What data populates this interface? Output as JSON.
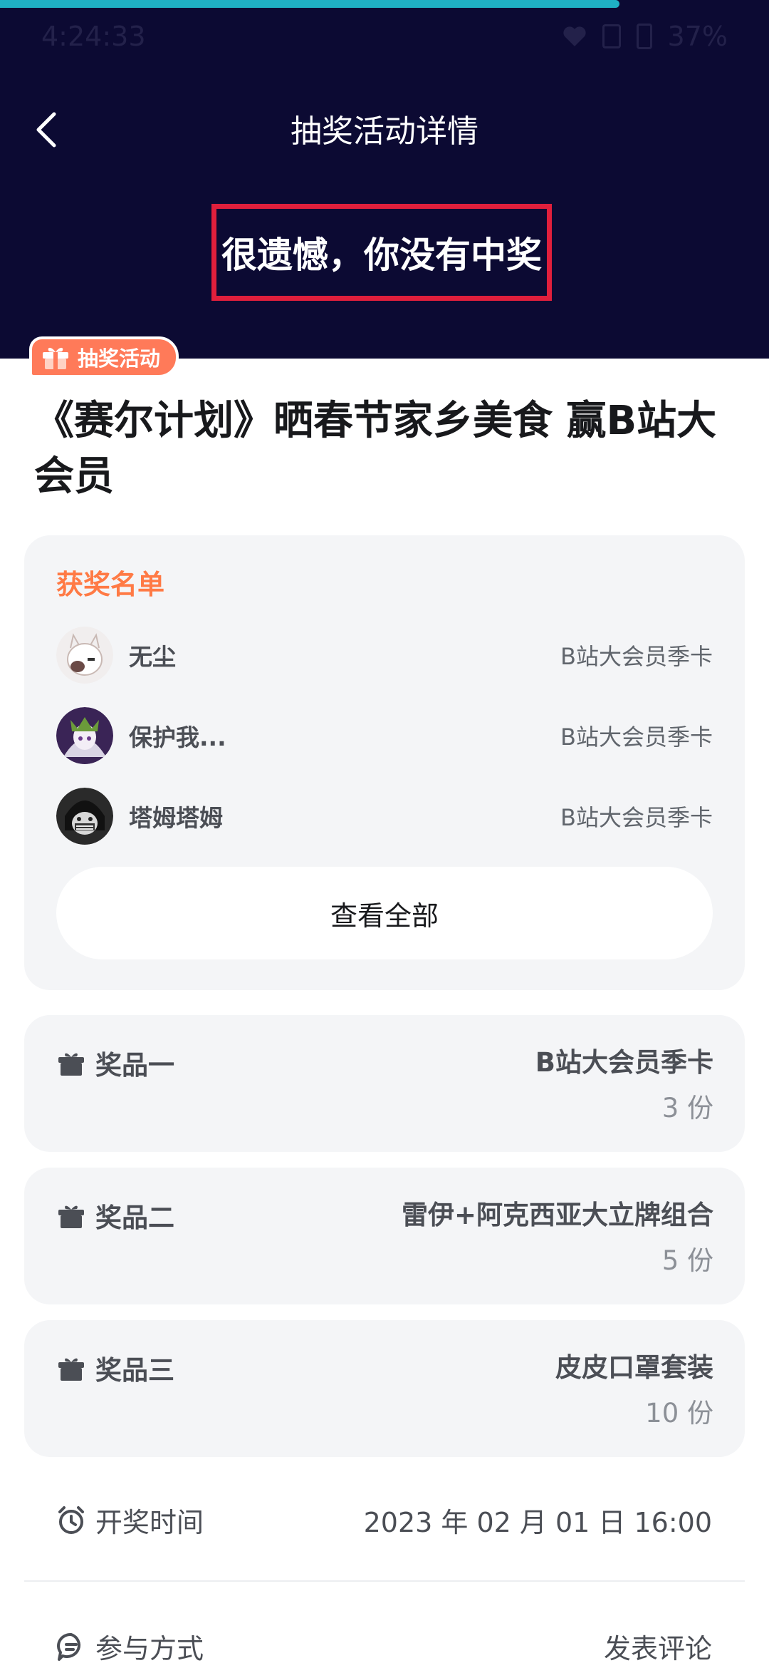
{
  "status_bar": {
    "time": "4:24:33",
    "battery": "37%"
  },
  "header": {
    "title": "抽奖活动详情",
    "result": "很遗憾，你没有中奖"
  },
  "activity": {
    "tag": "抽奖活动",
    "title": "《赛尔计划》晒春节家乡美食 赢B站大会员"
  },
  "winners": {
    "title": "获奖名单",
    "list": [
      {
        "name": "无尘",
        "prize": "B站大会员季卡"
      },
      {
        "name": "保护我...",
        "prize": "B站大会员季卡"
      },
      {
        "name": "塔姆塔姆",
        "prize": "B站大会员季卡"
      }
    ],
    "view_all": "查看全部"
  },
  "prizes": [
    {
      "label": "奖品一",
      "name": "B站大会员季卡",
      "count": "3 份"
    },
    {
      "label": "奖品二",
      "name": "雷伊+阿克西亚大立牌组合",
      "count": "5 份"
    },
    {
      "label": "奖品三",
      "name": "皮皮口罩套装",
      "count": "10 份"
    }
  ],
  "draw_time": {
    "label": "开奖时间",
    "value": "2023 年 02 月 01 日 16:00"
  },
  "participation": {
    "label": "参与方式",
    "value": "发表评论"
  },
  "colors": {
    "header_bg": "#0c0a33",
    "accent": "#ff7a59",
    "highlight_border": "#e01f3c"
  }
}
